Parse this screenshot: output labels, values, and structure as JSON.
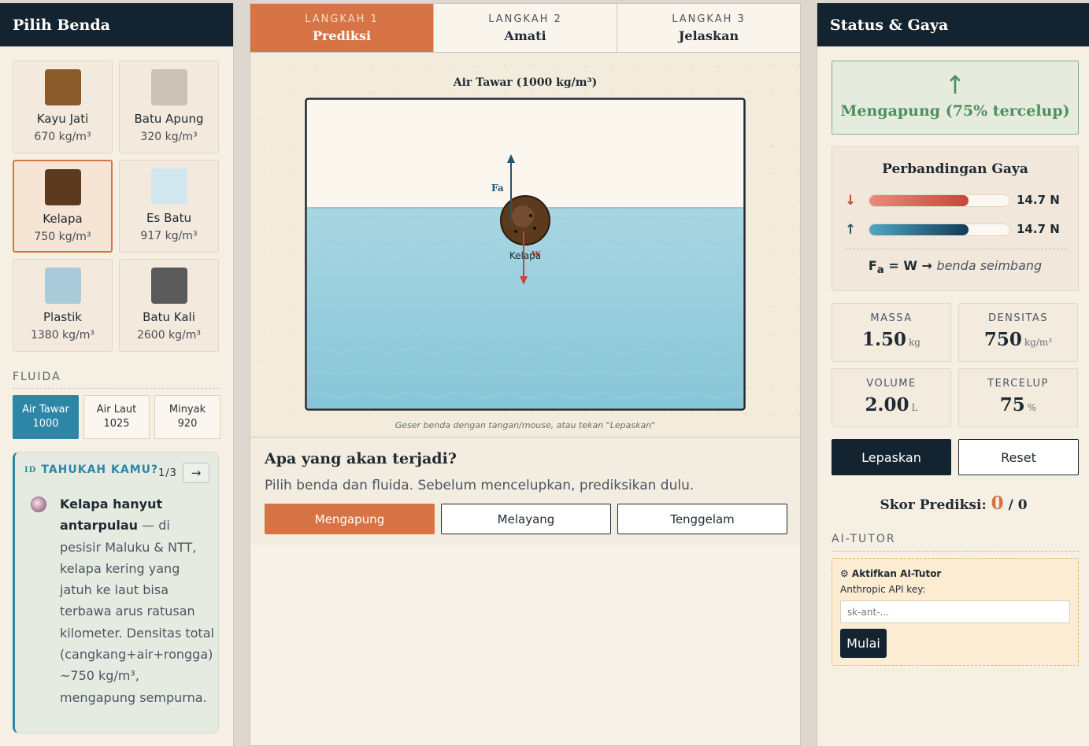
{
  "left": {
    "title": "Pilih Benda",
    "objects": [
      {
        "name": "Kayu Jati",
        "density": "670 kg/m³",
        "color": "#8a5a2b",
        "selected": false
      },
      {
        "name": "Batu Apung",
        "density": "320 kg/m³",
        "color": "#cbc2b5",
        "selected": false
      },
      {
        "name": "Kelapa",
        "density": "750 kg/m³",
        "color": "#5c3a1e",
        "selected": true
      },
      {
        "name": "Es Batu",
        "density": "917 kg/m³",
        "color": "#d2e7f0",
        "selected": false
      },
      {
        "name": "Plastik",
        "density": "1380 kg/m³",
        "color": "#a9cad8",
        "selected": false
      },
      {
        "name": "Batu Kali",
        "density": "2600 kg/m³",
        "color": "#5a5a5a",
        "selected": false
      }
    ],
    "fluid_label": "FLUIDA",
    "fluids": [
      {
        "name": "Air Tawar",
        "density": "1000",
        "active": true
      },
      {
        "name": "Air Laut",
        "density": "1025",
        "active": false
      },
      {
        "name": "Minyak",
        "density": "920",
        "active": false
      }
    ],
    "fact": {
      "badge": "ID",
      "heading": "TAHUKAH KAMU?",
      "counter": "1/3",
      "next_icon": "→",
      "bold": "Kelapa hanyut antarpulau",
      "text": " — di pesisir Maluku & NTT, kelapa kering yang jatuh ke laut bisa terbawa arus ratusan kilometer. Densitas total (cangkang+air+rongga) ~750 kg/m³, mengapung sempurna."
    }
  },
  "center": {
    "steps": [
      {
        "num": "LANGKAH 1",
        "title": "Prediksi",
        "active": true
      },
      {
        "num": "LANGKAH 2",
        "title": "Amati",
        "active": false
      },
      {
        "num": "LANGKAH 3",
        "title": "Jelaskan",
        "active": false
      }
    ],
    "tank_label": "Air Tawar (1000 kg/m³)",
    "object_label": "Kelapa",
    "fa_label": "Fa",
    "w_label": "w",
    "hint": "Geser benda dengan tangan/mouse, atau tekan \"Lepaskan\"",
    "question_title": "Apa yang akan terjadi?",
    "question_sub": "Pilih benda dan fluida. Sebelum mencelupkan, prediksikan dulu.",
    "predictions": [
      {
        "label": "Mengapung",
        "active": true
      },
      {
        "label": "Melayang",
        "active": false
      },
      {
        "label": "Tenggelam",
        "active": false
      }
    ],
    "colors": {
      "water": "#8ccbdc",
      "air": "#fbf7ee",
      "fa_arrow": "#1d5673",
      "w_arrow": "#c8453a",
      "object": "#5c3a1e"
    }
  },
  "right": {
    "title": "Status & Gaya",
    "status_icon": "↑",
    "status_text": "Mengapung (75% tercelup)",
    "force_title": "Perbandingan Gaya",
    "weight": {
      "icon": "↓",
      "value": "14.7 N",
      "fraction": 0.71
    },
    "buoyancy": {
      "icon": "↑",
      "value": "14.7 N",
      "fraction": 0.71
    },
    "equation_fa": "F",
    "equation_sub": "a",
    "equation_mid": " = W → ",
    "equation_note": "benda seimbang",
    "stats": [
      {
        "label": "MASSA",
        "value": "1.50",
        "unit": "kg"
      },
      {
        "label": "DENSITAS",
        "value": "750",
        "unit": "kg/m³"
      },
      {
        "label": "VOLUME",
        "value": "2.00",
        "unit": "L"
      },
      {
        "label": "TERCELUP",
        "value": "75",
        "unit": "%"
      }
    ],
    "release_label": "Lepaskan",
    "reset_label": "Reset",
    "score_label": "Skor Prediksi: ",
    "score_hit": "0",
    "score_total": " / 0",
    "ai_label": "AI-TUTOR",
    "ai_title": "⚙ Aktifkan AI-Tutor",
    "ai_sub": "Anthropic API key:",
    "ai_placeholder": "sk-ant-...",
    "ai_button": "Mulai"
  }
}
